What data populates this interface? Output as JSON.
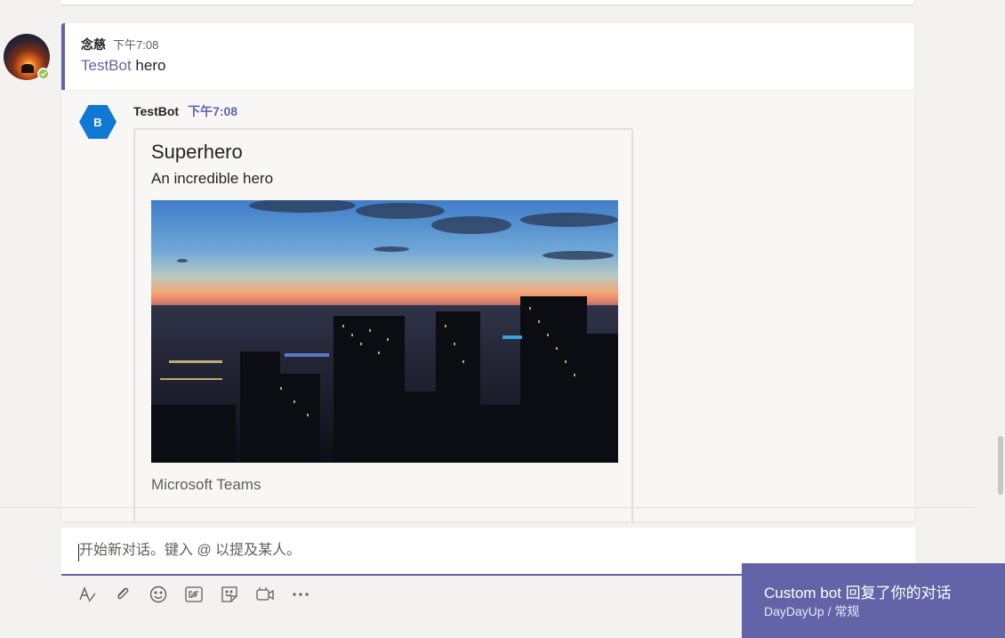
{
  "root_message": {
    "sender": "念慈",
    "time": "下午7:08",
    "mention": "TestBot",
    "text": " hero"
  },
  "reply": {
    "sender": "TestBot",
    "time": "下午7:08",
    "bot_initial": "B"
  },
  "hero_card": {
    "title": "Superhero",
    "subtitle": "An incredible hero",
    "text": "Microsoft Teams"
  },
  "composer": {
    "placeholder": "开始新对话。键入 @ 以提及某人。"
  },
  "toolbar": {
    "icons": [
      "format-icon",
      "attach-icon",
      "emoji-icon",
      "gif-icon",
      "sticker-icon",
      "meet-now-icon",
      "more-options-icon"
    ]
  },
  "toast": {
    "title": "Custom bot 回复了你的对话",
    "team": "DayDayUp",
    "separator": " / ",
    "channel": "常规"
  },
  "colors": {
    "brand": "#6264a7",
    "presence_available": "#92c353",
    "bot_avatar": "#0f78d4"
  }
}
